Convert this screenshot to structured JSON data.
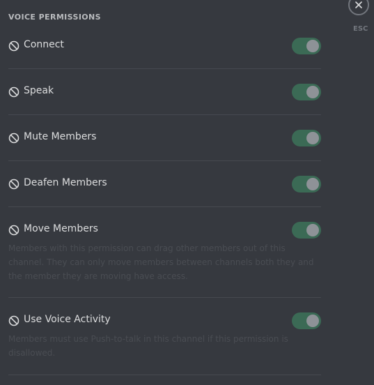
{
  "section": {
    "title": "VOICE PERMISSIONS"
  },
  "close": {
    "esc_label": "ESC",
    "icon": "close-icon"
  },
  "permissions": [
    {
      "label": "Connect",
      "description": "",
      "icon": "block-icon"
    },
    {
      "label": "Speak",
      "description": "",
      "icon": "block-icon"
    },
    {
      "label": "Mute Members",
      "description": "",
      "icon": "block-icon"
    },
    {
      "label": "Deafen Members",
      "description": "",
      "icon": "block-icon"
    },
    {
      "label": "Move Members",
      "description": "Members with this permission can drag other members out of this channel. They can only move members between channels both they and the member they are moving have access.",
      "icon": "block-icon"
    },
    {
      "label": "Use Voice Activity",
      "description": "Members must use Push-to-talk in this channel if this permission is disallowed.",
      "icon": "block-icon"
    }
  ],
  "colors": {
    "background": "#36393f",
    "toggle_track": "#3b6a55",
    "toggle_knob": "#8e9297",
    "text": "#dcddde",
    "muted_text": "#4a4d53"
  }
}
